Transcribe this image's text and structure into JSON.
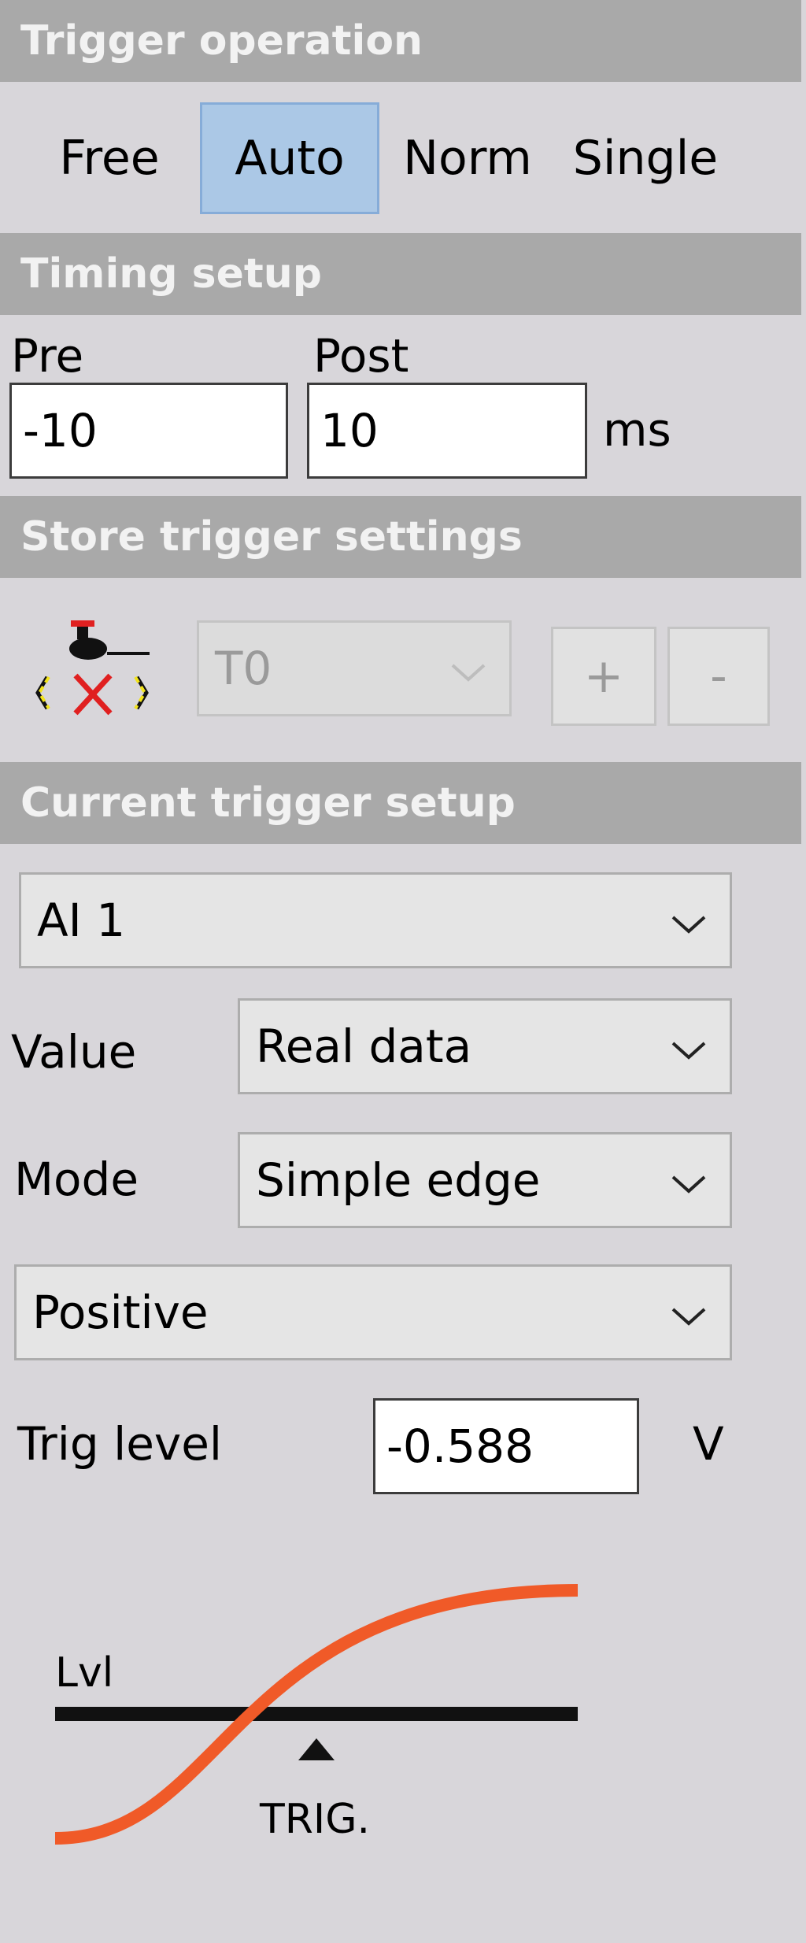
{
  "trigger_operation": {
    "title": "Trigger operation",
    "modes": [
      "Free",
      "Auto",
      "Norm",
      "Single"
    ],
    "selected": "Auto"
  },
  "timing_setup": {
    "title": "Timing setup",
    "pre_label": "Pre",
    "pre_value": "-10",
    "post_label": "Post",
    "post_value": "10",
    "unit": "ms"
  },
  "store_trigger": {
    "title": "Store trigger settings",
    "icon": "trigger-store-icon",
    "preset": "T0",
    "add_label": "+",
    "remove_label": "-"
  },
  "current_trigger": {
    "title": "Current trigger setup",
    "channel": "AI 1",
    "value_label": "Value",
    "value": "Real data",
    "mode_label": "Mode",
    "mode": "Simple edge",
    "edge": "Positive",
    "level_label": "Trig level",
    "level_value": "-0.588",
    "level_unit": "V"
  },
  "diagram": {
    "level_label": "Lvl",
    "trig_label": "TRIG.",
    "curve_color": "#f05a28",
    "line_color": "#111111"
  }
}
